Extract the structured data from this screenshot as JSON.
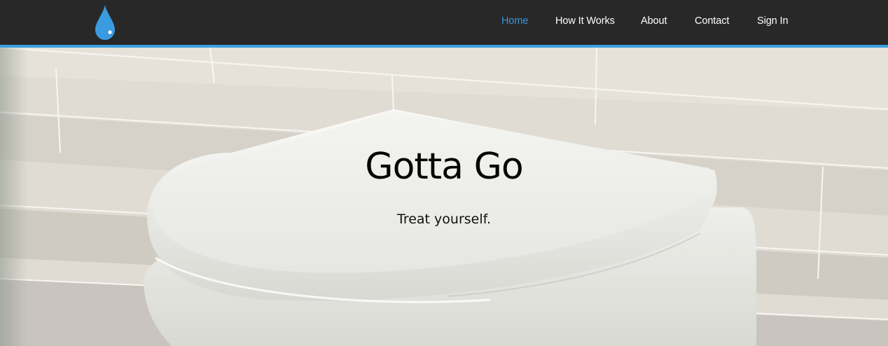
{
  "nav": {
    "logo_icon": "water-drop-icon",
    "accent_color": "#3aa0e0",
    "items": [
      {
        "label": "Home",
        "active": true
      },
      {
        "label": "How It Works",
        "active": false
      },
      {
        "label": "About",
        "active": false
      },
      {
        "label": "Contact",
        "active": false
      },
      {
        "label": "Sign In",
        "active": false
      }
    ]
  },
  "hero": {
    "title": "Gotta Go",
    "tagline": "Treat yourself."
  }
}
